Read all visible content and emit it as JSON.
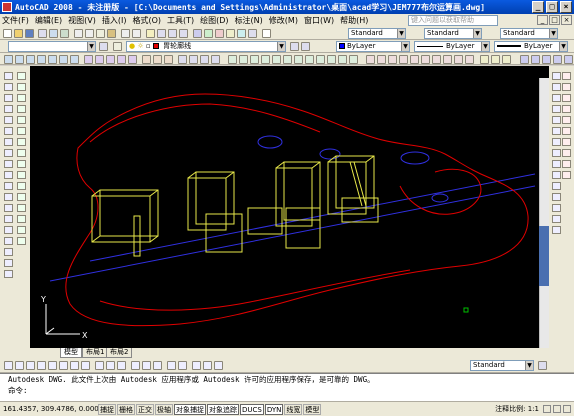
{
  "title": "AutoCAD 2008 - 未注册版 - [C:\\Documents and Settings\\Administrator\\桌面\\acad学习\\JEM777布尔运算画.dwg]",
  "window_controls": {
    "minimize": "_",
    "maximize": "□",
    "close": "×"
  },
  "menu": [
    "文件(F)",
    "编辑(E)",
    "视图(V)",
    "插入(I)",
    "格式(O)",
    "工具(T)",
    "绘图(D)",
    "标注(N)",
    "修改(M)",
    "窗口(W)",
    "帮助(H)"
  ],
  "search_placeholder": "键入问题以获取帮助",
  "toolbar_style1": "Standard",
  "toolbar_style2": "Standard",
  "toolbar_style3": "Standard",
  "layer_combo": "胃轮廓线",
  "color_combo": "ByLayer",
  "linetype_combo": "ByLayer",
  "lineweight_combo": "ByLayer",
  "tabs": [
    "模型",
    "布局1",
    "布局2"
  ],
  "bottom_style_combo": "Standard",
  "command_lines": [
    "Autodesk DWG.  此文件上次由 Autodesk 应用程序或 Autodesk 许可的应用程序保存，是可靠的 DWG。",
    "命令:"
  ],
  "coordinates": "161.4357, 309.4786, 0.0000",
  "status_buttons": [
    "捕捉",
    "栅格",
    "正交",
    "极轴",
    "对象捕捉",
    "对象追踪",
    "DUCS",
    "DYN",
    "线宽",
    "模型"
  ],
  "annotation_scale": "注释比例: 1:1",
  "ucs_labels": {
    "x": "X",
    "y": "Y"
  },
  "colors": {
    "outline": "#e00000",
    "solid": "#e8e84a",
    "axis": "#3030e0",
    "grid_marker": "#00c000"
  }
}
